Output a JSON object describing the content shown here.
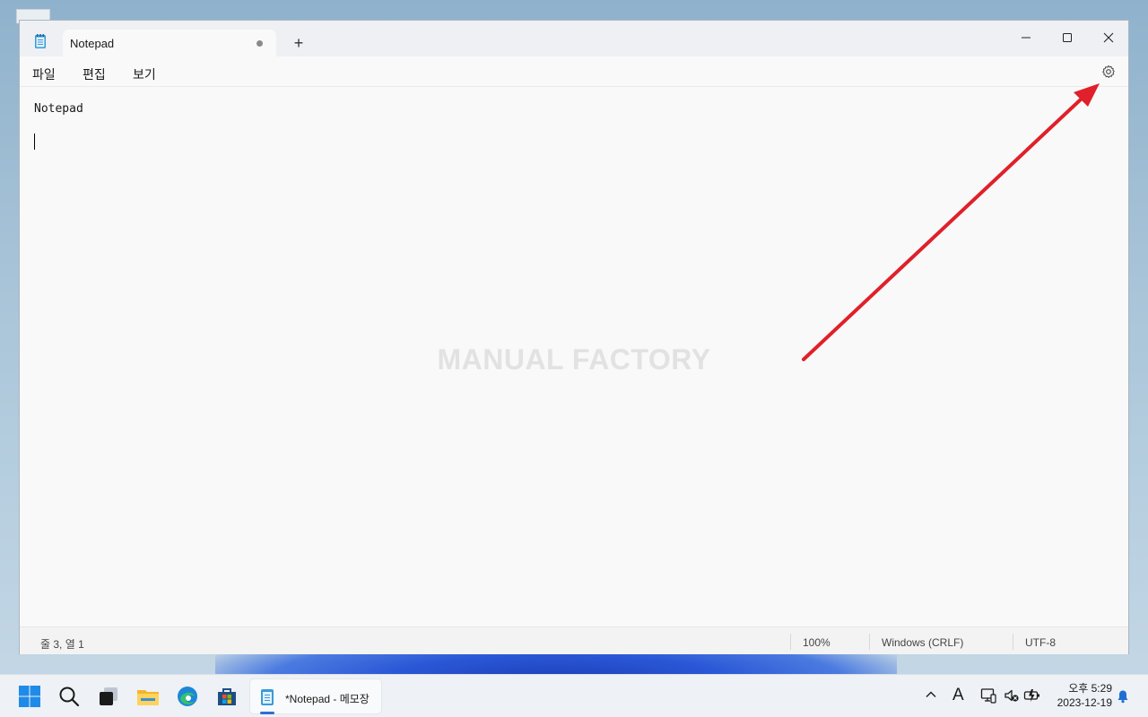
{
  "window": {
    "tab_title": "Notepad",
    "new_tab": "+",
    "menu": {
      "file": "파일",
      "edit": "편집",
      "view": "보기"
    },
    "settings_icon": "gear-icon"
  },
  "editor": {
    "lines": [
      "Notepad"
    ],
    "watermark": "MANUAL FACTORY"
  },
  "status": {
    "position": "줄 3, 열 1",
    "zoom": "100%",
    "line_ending": "Windows (CRLF)",
    "encoding": "UTF-8"
  },
  "taskbar": {
    "active_app": "*Notepad - 메모장",
    "clock_time": "오후 5:29",
    "clock_date": "2023-12-19",
    "ime": "A"
  },
  "colors": {
    "accent": "#2b6fd6",
    "annotation_arrow": "#e0202a"
  }
}
